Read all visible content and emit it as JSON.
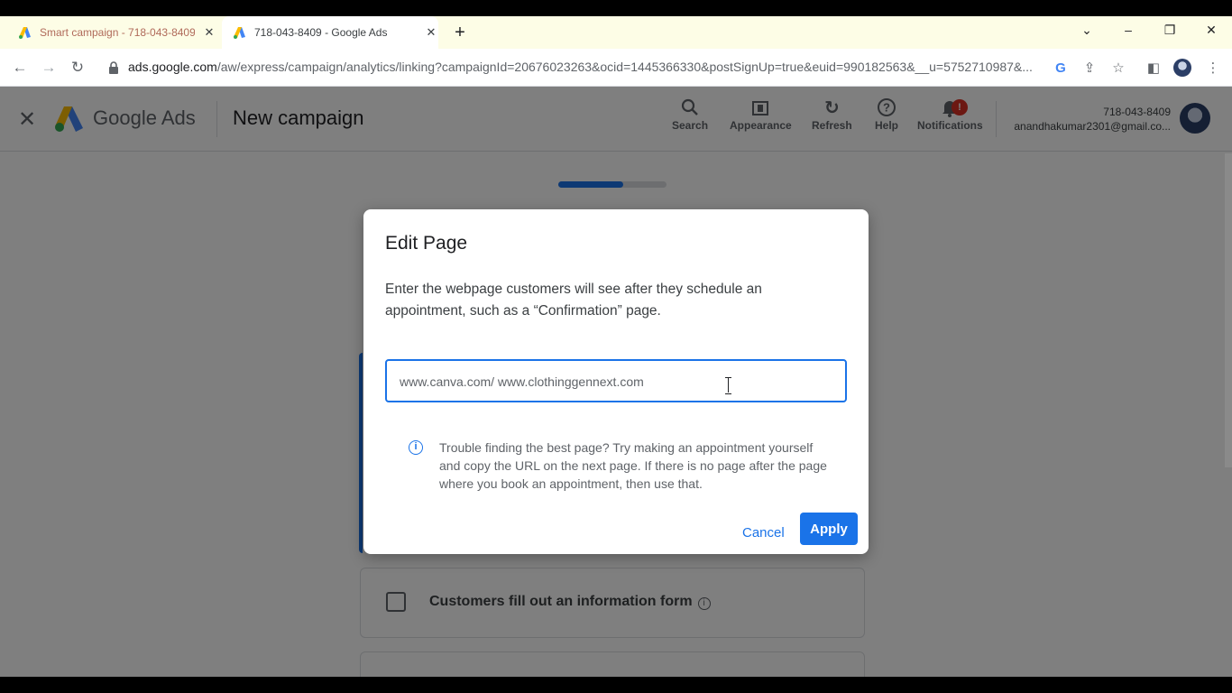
{
  "browser": {
    "tabs": [
      {
        "title": "Smart campaign - 718-043-8409",
        "active": false
      },
      {
        "title": "718-043-8409 - Google Ads",
        "active": true
      }
    ],
    "new_tab_glyph": "+",
    "window_controls": {
      "menu": "⌄",
      "minimize": "–",
      "restore": "❐",
      "close": "✕"
    },
    "address": {
      "host": "ads.google.com",
      "path": "/aw/express/campaign/analytics/linking?campaignId=20676023263&ocid=1445366330&postSignUp=true&euid=990182563&__u=5752710987&..."
    }
  },
  "header": {
    "brand": "Google Ads",
    "page_title": "New campaign",
    "tools": [
      {
        "label": "Search",
        "icon": "search-icon"
      },
      {
        "label": "Appearance",
        "icon": "appearance-icon"
      },
      {
        "label": "Refresh",
        "icon": "refresh-icon"
      },
      {
        "label": "Help",
        "icon": "help-icon"
      },
      {
        "label": "Notifications",
        "icon": "bell-icon",
        "badge": "!"
      }
    ],
    "account": {
      "id": "718-043-8409",
      "email": "anandhakumar2301@gmail.co..."
    }
  },
  "progress": {
    "fraction": 0.6
  },
  "background": {
    "info_form_card": "Customers fill out an information form"
  },
  "dialog": {
    "title": "Edit Page",
    "description": "Enter the webpage customers will see after they schedule an appointment, such as a “Confirmation” page.",
    "url_value": "www.canva.com/ www.clothinggennext.com",
    "help_text": "Trouble finding the best page? Try making an appointment yourself and copy the URL on the next page. If there is no page after the page where you book an appointment, then use that.",
    "cancel_label": "Cancel",
    "apply_label": "Apply"
  },
  "colors": {
    "accent": "#1a73e8",
    "badge": "#d93025"
  }
}
